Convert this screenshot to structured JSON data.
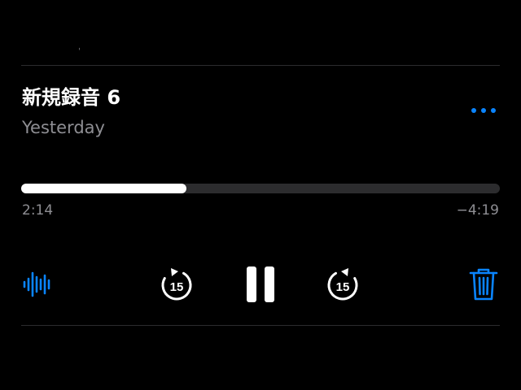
{
  "recording": {
    "title": "新規録音 6",
    "date": "Yesterday"
  },
  "playback": {
    "elapsed": "2:14",
    "remaining": "−4:19",
    "progress_fraction": 0.345
  },
  "controls": {
    "skip_back_seconds": "15",
    "skip_forward_seconds": "15"
  },
  "icons": {
    "more": "ellipsis-icon",
    "waveform": "waveform-icon",
    "skip_back": "rewind-15-icon",
    "pause": "pause-icon",
    "skip_forward": "forward-15-icon",
    "trash": "trash-icon"
  },
  "colors": {
    "accent": "#0a84ff",
    "background": "#000000",
    "text_primary": "#ffffff",
    "text_secondary": "#8e8e93",
    "track": "#2c2c2e"
  }
}
